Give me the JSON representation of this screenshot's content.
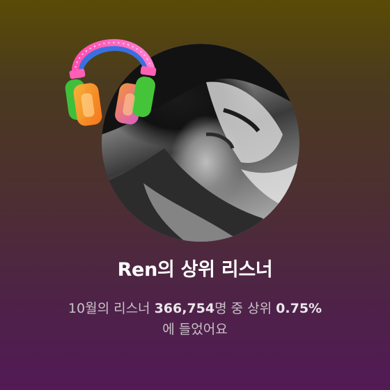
{
  "card": {
    "title": "Ren의 상위 리스너",
    "subtitle_line1_parts": [
      "10월의 리스너 ",
      "366,754",
      "명 중 상위 ",
      "0.75%"
    ],
    "subtitle_line2": "에 들었어요",
    "colors": {
      "background_top": "#5a4b06",
      "background_bottom": "#521a56",
      "title": "#ffffff",
      "subtitle": "#c9c2c8"
    },
    "icons": {
      "badge": "headphones-icon",
      "artist_photo": "artist-avatar"
    }
  }
}
